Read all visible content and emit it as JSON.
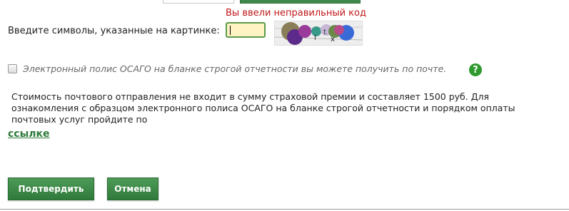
{
  "captcha": {
    "error": "Вы ввели неправильный код",
    "label": "Введите символы, указанные на картинке:",
    "input_value": ""
  },
  "epolicy": {
    "checked": false,
    "label": "Электронный полис ОСАГО на бланке строгой отчетности вы можете получить по почте.",
    "help_icon": "question-circle-icon"
  },
  "info": {
    "text": "Стоимость почтового отправления не входит в сумму страховой премии и составляет 1500 руб. Для ознакомления с образцом электронного полиса ОСАГО на бланке строгой отчетности и порядком оплаты почтовых услуг пройдите по",
    "link_label": "ссылке"
  },
  "buttons": {
    "confirm_label": "Подтвердить",
    "cancel_label": "Отмена"
  },
  "colors": {
    "accent_green": "#2f7a3b",
    "error_red": "#c0191b",
    "input_bg": "#fff3c4"
  }
}
